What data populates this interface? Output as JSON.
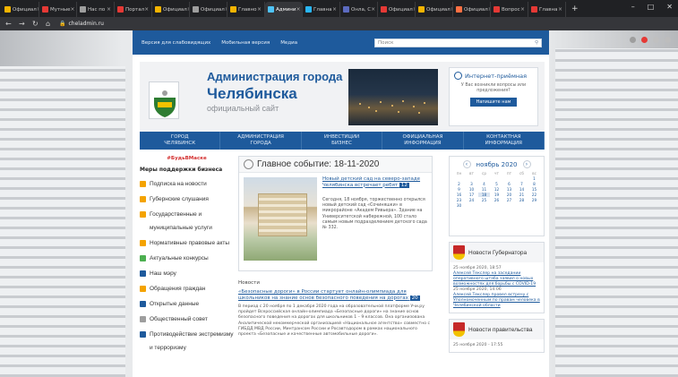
{
  "browser": {
    "tabs": [
      {
        "label": "Официал",
        "color": "#f4b400"
      },
      {
        "label": "Мутные",
        "color": "#e53935"
      },
      {
        "label": "Нас по",
        "color": "#9e9e9e"
      },
      {
        "label": "Портал",
        "color": "#e53935"
      },
      {
        "label": "Официал",
        "color": "#f4b400"
      },
      {
        "label": "Официал",
        "color": "#9e9e9e"
      },
      {
        "label": "Главно",
        "color": "#f4b400"
      },
      {
        "label": "Админи",
        "color": "#4fc3f7"
      },
      {
        "label": "Главна",
        "color": "#29b6f6"
      },
      {
        "label": "Онла, С",
        "color": "#5c6bc0"
      },
      {
        "label": "Официал",
        "color": "#e53935"
      },
      {
        "label": "Официал",
        "color": "#f4b400"
      },
      {
        "label": "Официал",
        "color": "#ff7043"
      },
      {
        "label": "Вопрос",
        "color": "#e53935"
      },
      {
        "label": "Главна",
        "color": "#e53935"
      }
    ],
    "active_tab": 7,
    "url": "cheladmin.ru",
    "new_tab": "+",
    "minimize": "–",
    "maximize": "□",
    "close": "✕"
  },
  "topbar": {
    "link_impaired": "Версия для слабовидящих",
    "link_mobile": "Мобильная версия",
    "link_media": "Медиа",
    "search_placeholder": "Поиск"
  },
  "header": {
    "title_line1": "Администрация города",
    "title_line2": "Челябинска",
    "subtitle": "официальный сайт",
    "reception_title": "Интернет-приёмная",
    "reception_text": "У Вас возникли вопросы или предложения?",
    "reception_button": "Напишите нам"
  },
  "mainnav": [
    {
      "line1": "ГОРОД",
      "line2": "ЧЕЛЯБИНСК"
    },
    {
      "line1": "АДМИНИСТРАЦИЯ",
      "line2": "ГОРОДА"
    },
    {
      "line1": "ИНВЕСТИЦИИ",
      "line2": "БИЗНЕС"
    },
    {
      "line1": "ОФИЦИАЛЬНАЯ",
      "line2": "ИНФОРМАЦИЯ"
    },
    {
      "line1": "КОНТАКТНАЯ",
      "line2": "ИНФОРМАЦИЯ"
    }
  ],
  "sidebar": {
    "hashtag": "#БудьВМаске",
    "heading": "Меры поддержки бизнеса",
    "items": [
      {
        "label": "Подписка на новости",
        "color": "#f4a300"
      },
      {
        "label": "Губернские слушания",
        "color": "#f4a300"
      },
      {
        "label": "Государственные и муниципальные услуги",
        "color": "#f4a300"
      },
      {
        "label": "Нормативные правовые акты",
        "color": "#f4a300"
      },
      {
        "label": "Актуальные конкурсы",
        "color": "#4caf50"
      },
      {
        "label": "Наш мэру",
        "color": "#1e5a9c"
      },
      {
        "label": "Обращения граждан",
        "color": "#f4a300"
      },
      {
        "label": "Открытые данные",
        "color": "#1e5a9c"
      },
      {
        "label": "Общественный совет",
        "color": "#9e9e9e"
      },
      {
        "label": "Противодействие экстремизму и терроризму",
        "color": "#1e5a9c"
      }
    ]
  },
  "main_event": {
    "title": "Главное событие: 18-11-2020",
    "link": "Новый детский сад на северо-западе Челябинска встречает ребят",
    "count": "12",
    "text": "Сегодня, 18 ноября, торжественно открылся новый детский сад «Сочиняшки» в микрорайоне «Академ Ривьера». Здание на Университетской набережной, 100 стало самым новым подразделением детского сада № 332."
  },
  "news": {
    "label": "Новости",
    "link": "«Безопасные дороги» в России стартует онлайн-олимпиада для школьников на знание основ безопасного поведения на дорогах",
    "count": "20",
    "text": "В период с 20 ноября по 1 декабря 2020 года на образовательной платформе Учи.ру пройдет Всероссийская онлайн-олимпиада «Безопасные дороги» на знание основ безопасного поведения на дорогах для школьников 1 – 9 классов. Она организована Аналитической некоммерческой организацией «Национальное агентство» совместно с ГИБДД МВД России, Минтрансом России и Росавтодором в рамках национального проекта «Безопасные и качественные автомобильные дороги»."
  },
  "calendar": {
    "month": "ноябрь 2020",
    "prev": "‹",
    "next": "›",
    "weekdays": [
      "пн",
      "вт",
      "ср",
      "чт",
      "пт",
      "сб",
      "вс"
    ],
    "leading_blank": 6,
    "days": [
      "1",
      "2",
      "3",
      "4",
      "5",
      "6",
      "7",
      "8",
      "9",
      "10",
      "11",
      "12",
      "13",
      "14",
      "15",
      "16",
      "17",
      "18",
      "19",
      "20",
      "21",
      "22",
      "23",
      "24",
      "25",
      "26",
      "27",
      "28",
      "29",
      "30"
    ],
    "selected": "18"
  },
  "governor_news": {
    "title": "Новости Губернатора",
    "items": [
      {
        "date": "25 ноября 2020, 18:57",
        "text": "Алексей Текслер на заседании оперативного штаба заявил о новых возможностях для борьбы с COVID-19"
      },
      {
        "date": "25 ноября 2020, 14:06",
        "text": "Алексей Текслер провел встречу с Уполномоченным по правам человека в Челябинской области"
      }
    ]
  },
  "gov_news": {
    "title": "Новости правительства",
    "items": [
      {
        "date": "25 ноября 2020 - 17:55",
        "text": ""
      }
    ]
  }
}
